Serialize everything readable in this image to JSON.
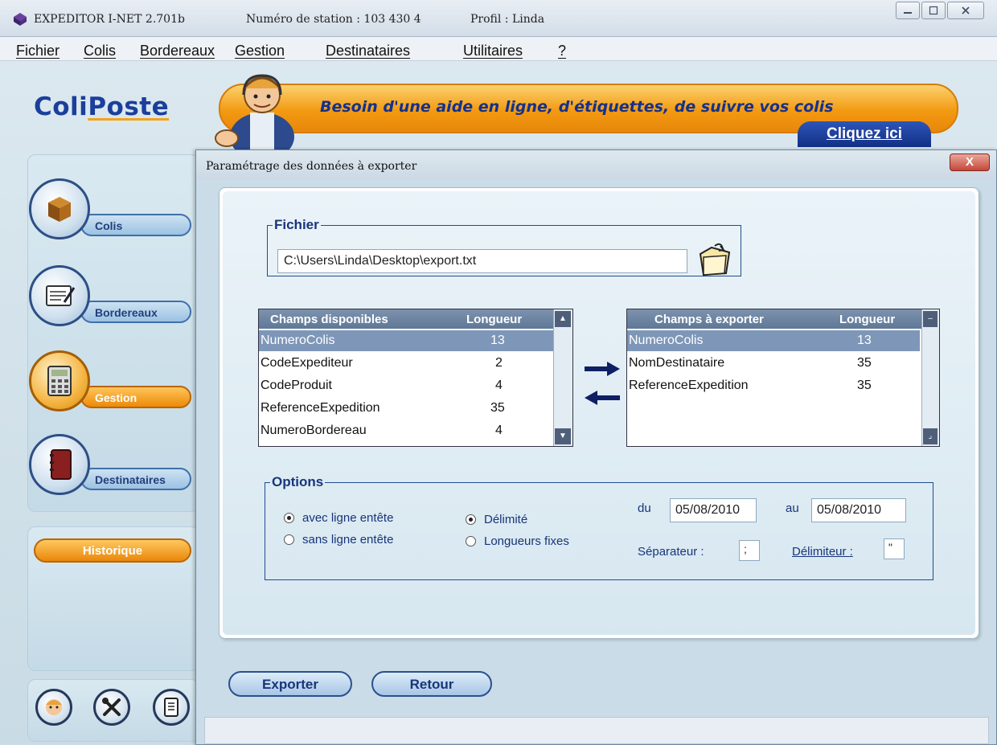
{
  "window": {
    "app_title": "EXPEDITOR I-NET 2.701b",
    "station": "Numéro de station : 103 430 4",
    "profile": "Profil : Linda",
    "controls": [
      "minimize",
      "maximize",
      "close"
    ]
  },
  "menu": {
    "items": [
      "Fichier",
      "Colis",
      "Bordereaux",
      "Gestion",
      "Destinataires",
      "Utilitaires",
      "?"
    ]
  },
  "header": {
    "logo_part1": "Coli",
    "logo_part2": "Poste",
    "banner_text": "Besoin d'une aide en ligne, d'étiquettes,  de suivre vos colis",
    "cliquez": "Cliquez ici"
  },
  "sidebar": {
    "items": [
      {
        "label": "Colis",
        "icon": "box-icon",
        "active": false
      },
      {
        "label": "Bordereaux",
        "icon": "notepad-icon",
        "active": false
      },
      {
        "label": "Gestion",
        "icon": "calculator-icon",
        "active": true
      },
      {
        "label": "Destinataires",
        "icon": "address-book-icon",
        "active": false
      }
    ],
    "historique": "Historique",
    "bottom_icons": [
      "support-agent-icon",
      "tools-icon",
      "document-icon"
    ]
  },
  "dialog": {
    "title": "Paramétrage des données à exporter",
    "close_label": "X",
    "fichier": {
      "legend": "Fichier",
      "path": "C:\\Users\\Linda\\Desktop\\export.txt",
      "browse_icon": "folder-icon"
    },
    "available": {
      "col1": "Champs disponibles",
      "col2": "Longueur",
      "rows": [
        {
          "name": "NumeroColis",
          "len": "13",
          "selected": true
        },
        {
          "name": "CodeExpediteur",
          "len": "2",
          "selected": false
        },
        {
          "name": "CodeProduit",
          "len": "4",
          "selected": false
        },
        {
          "name": "ReferenceExpedition",
          "len": "35",
          "selected": false
        },
        {
          "name": "NumeroBordereau",
          "len": "4",
          "selected": false
        }
      ]
    },
    "export": {
      "col1": "Champs à exporter",
      "col2": "Longueur",
      "rows": [
        {
          "name": "NumeroColis",
          "len": "13",
          "selected": true
        },
        {
          "name": "NomDestinataire",
          "len": "35",
          "selected": false
        },
        {
          "name": "ReferenceExpedition",
          "len": "35",
          "selected": false
        }
      ]
    },
    "options": {
      "legend": "Options",
      "header_with": "avec ligne entête",
      "header_without": "sans ligne entête",
      "delimited": "Délimité",
      "fixed": "Longueurs fixes",
      "du_label": "du",
      "du_value": "05/08/2010",
      "au_label": "au",
      "au_value": "05/08/2010",
      "separator_label": "Séparateur :",
      "separator_value": ";",
      "delimiter_label": "Délimiteur :",
      "delimiter_value": "\""
    },
    "buttons": {
      "export": "Exporter",
      "back": "Retour"
    }
  },
  "colors": {
    "accent_orange": "#f39a12",
    "brand_blue": "#1a3f9c",
    "selection": "#7e96b8"
  }
}
